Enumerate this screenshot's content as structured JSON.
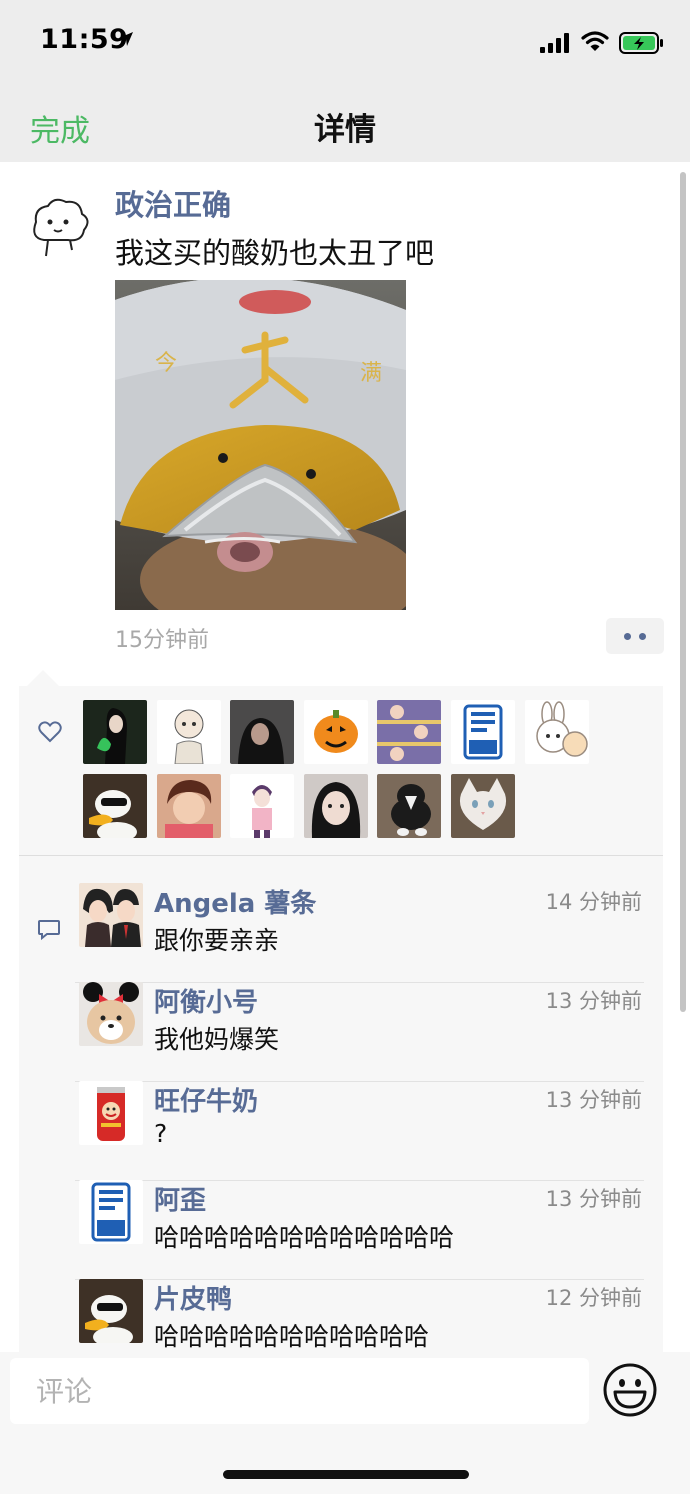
{
  "status_bar": {
    "time": "11:59"
  },
  "nav": {
    "done_label": "完成",
    "title": "详情"
  },
  "post": {
    "author": "政治正确",
    "text": "我这买的酸奶也太丑了吧",
    "time": "15分钟前"
  },
  "likes": {
    "avatars": [
      "avatar-1",
      "avatar-2",
      "avatar-3",
      "avatar-4",
      "avatar-5",
      "avatar-6",
      "avatar-7",
      "avatar-8",
      "avatar-9",
      "avatar-10",
      "avatar-11",
      "avatar-12",
      "avatar-13"
    ]
  },
  "comments": [
    {
      "name": "Angela 薯条",
      "time": "14 分钟前",
      "text": "跟你要亲亲"
    },
    {
      "name": "阿衡小号",
      "time": "13 分钟前",
      "text": "我他妈爆笑"
    },
    {
      "name": "旺仔牛奶",
      "time": "13 分钟前",
      "text": "?"
    },
    {
      "name": "阿歪",
      "time": "13 分钟前",
      "text": "哈哈哈哈哈哈哈哈哈哈哈哈"
    },
    {
      "name": "片皮鸭",
      "time": "12 分钟前",
      "text": "哈哈哈哈哈哈哈哈哈哈哈"
    }
  ],
  "input": {
    "placeholder": "评论"
  },
  "colors": {
    "accent": "#4cb964",
    "link": "#576b95"
  },
  "icons": [
    "location-arrow-icon",
    "signal-icon",
    "wifi-icon",
    "battery-icon",
    "heart-icon",
    "comment-icon",
    "emoji-icon"
  ]
}
